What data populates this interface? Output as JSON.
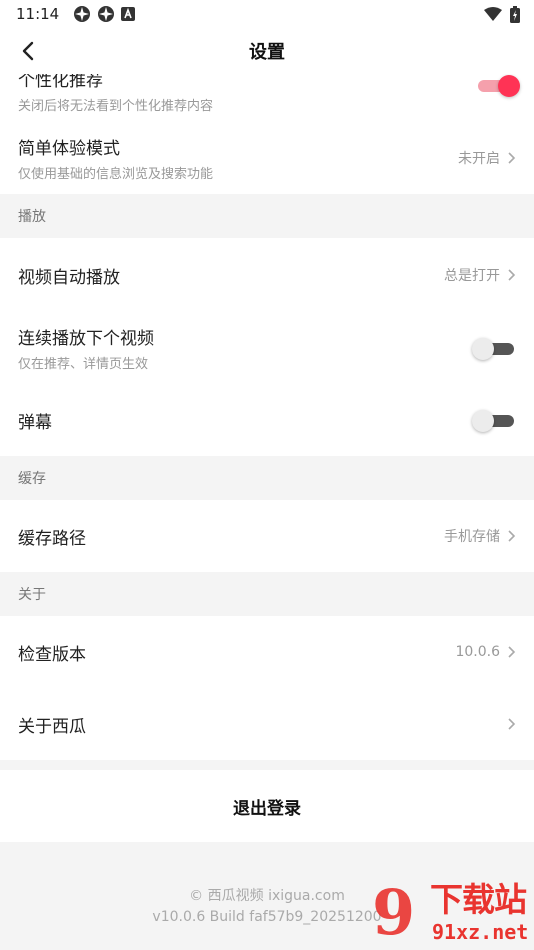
{
  "status_bar": {
    "time": "11:14",
    "icons": [
      "app-icon",
      "app-icon",
      "a-icon"
    ],
    "right_icons": [
      "wifi-icon",
      "battery-icon"
    ]
  },
  "nav": {
    "title": "设置"
  },
  "rows": {
    "personalized_label": "个性化推荐",
    "personalized_sub": "关闭后将无法看到个性化推荐内容",
    "personalized_on": true,
    "simple_mode_label": "简单体验模式",
    "simple_mode_sub": "仅使用基础的信息浏览及搜索功能",
    "simple_mode_value": "未开启",
    "autoplay_label": "视频自动播放",
    "autoplay_value": "总是打开",
    "continuous_label": "连续播放下个视频",
    "continuous_sub": "仅在推荐、详情页生效",
    "continuous_on": false,
    "danmaku_label": "弹幕",
    "danmaku_on": false,
    "cache_path_label": "缓存路径",
    "cache_path_value": "手机存储",
    "check_version_label": "检查版本",
    "check_version_value": "10.0.6",
    "about_label": "关于西瓜"
  },
  "sections": {
    "playback": "播放",
    "cache": "缓存",
    "about": "关于"
  },
  "logout_label": "退出登录",
  "footer": {
    "copyright": "© 西瓜视频 ixigua.com",
    "build": "v10.0.6 Build faf57b9_20251200"
  },
  "watermark": {
    "big": "9",
    "cn": "下载站",
    "url": "91xz.net"
  },
  "colors": {
    "accent": "#ff3355",
    "background": "#f4f4f4",
    "card": "#ffffff",
    "watermark": "#e9342f"
  }
}
